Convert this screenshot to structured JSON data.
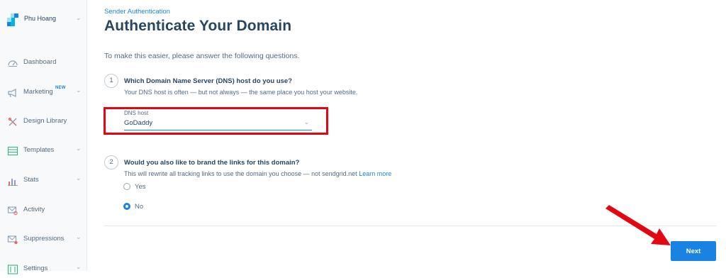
{
  "sidebar": {
    "user_name": "Phu Hoang",
    "items": [
      {
        "label": "Dashboard",
        "icon": "speedometer-icon",
        "chevron": false
      },
      {
        "label": "Marketing",
        "icon": "megaphone-icon",
        "badge": "NEW",
        "chevron": true
      },
      {
        "label": "Design Library",
        "icon": "design-tools-icon",
        "chevron": false
      },
      {
        "label": "Templates",
        "icon": "templates-icon",
        "chevron": true
      },
      {
        "label": "Stats",
        "icon": "bar-chart-icon",
        "chevron": true
      },
      {
        "label": "Activity",
        "icon": "mail-search-icon",
        "chevron": false
      },
      {
        "label": "Suppressions",
        "icon": "suppression-icon",
        "chevron": true
      },
      {
        "label": "Settings",
        "icon": "settings-icon",
        "chevron": true
      }
    ],
    "chevron_glyph": "⌄"
  },
  "header": {
    "breadcrumb": "Sender Authentication",
    "title": "Authenticate Your Domain"
  },
  "intro": "To make this easier, please answer the following questions.",
  "questions": [
    {
      "number": "1",
      "title": "Which Domain Name Server (DNS) host do you use?",
      "help": "Your DNS host is often — but not always — the same place you host your website.",
      "field_label": "DNS host",
      "field_value": "GoDaddy"
    },
    {
      "number": "2",
      "title": "Would you also like to brand the links for this domain?",
      "help": "This will rewrite all tracking links to use the domain you choose — not sendgrid.net",
      "help_link": "Learn more",
      "options": [
        "Yes",
        "No"
      ],
      "selected": "No"
    }
  ],
  "next_button": "Next",
  "colors": {
    "accent": "#1a82e2",
    "highlight": "#e30613",
    "heading": "#294661"
  }
}
